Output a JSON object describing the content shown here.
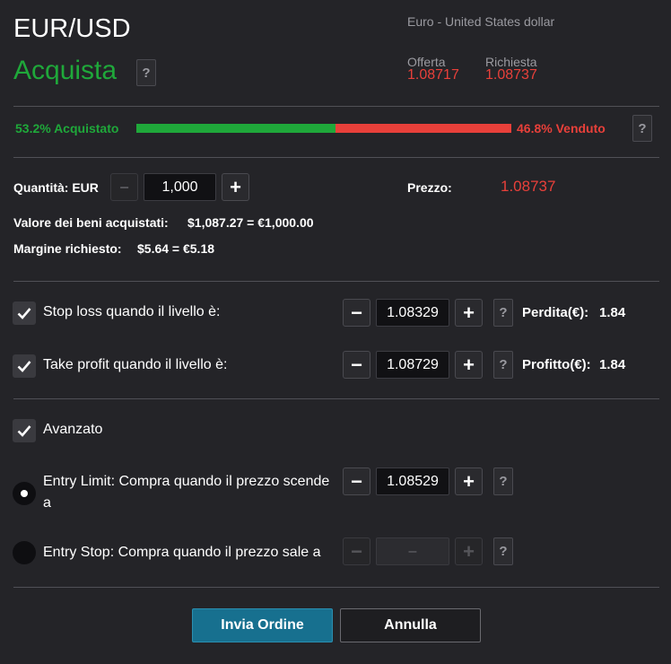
{
  "header": {
    "symbol": "EUR/USD",
    "description": "Euro - United States dollar",
    "action": "Acquista",
    "help": "?"
  },
  "quotes": {
    "bid_label": "Offerta",
    "bid_value": "1.08717",
    "ask_label": "Richiesta",
    "ask_value": "1.08737"
  },
  "sentiment": {
    "bought_label": "53.2% Acquistato",
    "sold_label": "46.8% Venduto",
    "bought_percent": 53.2,
    "help": "?"
  },
  "quantity": {
    "label": "Quantità: EUR",
    "minus": "−",
    "value": "1,000",
    "plus": "+",
    "price_label": "Prezzo:",
    "price_value": "1.08737"
  },
  "values": {
    "assets_label": "Valore dei beni acquistati:",
    "assets_value": "$1,087.27 = €1,000.00",
    "margin_label": "Margine richiesto:",
    "margin_value": "$5.64 = €5.18"
  },
  "stop_loss": {
    "label": "Stop loss quando il livello è:",
    "value": "1.08329",
    "minus": "−",
    "plus": "+",
    "help": "?",
    "result_label": "Perdita(€):",
    "result_value": "1.84",
    "checked": true
  },
  "take_profit": {
    "label": "Take profit quando il livello è:",
    "value": "1.08729",
    "minus": "−",
    "plus": "+",
    "help": "?",
    "result_label": "Profitto(€):",
    "result_value": "1.84",
    "checked": true
  },
  "advanced": {
    "label": "Avanzato",
    "checked": true
  },
  "entry_limit": {
    "label_line1": "Entry Limit: Compra quando il prezzo scende",
    "label_line2": "a",
    "value": "1.08529",
    "minus": "−",
    "plus": "+",
    "help": "?",
    "selected": true
  },
  "entry_stop": {
    "label": "Entry Stop: Compra quando il prezzo sale a",
    "value": "–",
    "minus": "−",
    "plus": "+",
    "help": "?",
    "selected": false
  },
  "footer": {
    "submit": "Invia Ordine",
    "cancel": "Annulla"
  },
  "colors": {
    "green": "#1fa83a",
    "red": "#e8403a",
    "primary": "#17708f"
  }
}
